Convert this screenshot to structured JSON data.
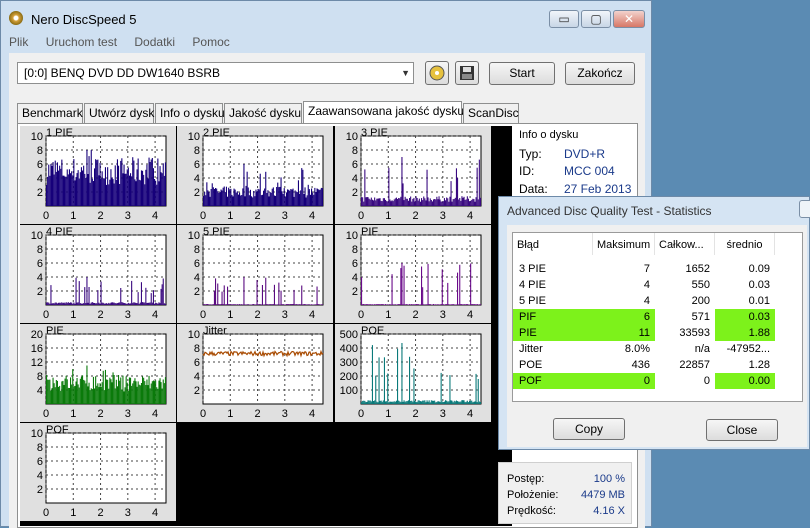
{
  "window": {
    "title": "Nero DiscSpeed 5",
    "minimize": "▭",
    "maximize": "▢",
    "close": "✕"
  },
  "menu": [
    "Plik",
    "Uruchom test",
    "Dodatki",
    "Pomoc"
  ],
  "toolbar": {
    "drive": "[0:0]   BENQ DVD DD DW1640 BSRB",
    "start": "Start",
    "stop": "Zakończ"
  },
  "tabs": [
    "Benchmark",
    "Utwórz dysk",
    "Info o dysku",
    "Jakość dysku",
    "Zaawansowana jakość dysku",
    "ScanDisc"
  ],
  "active_tab": 4,
  "disc_info": {
    "header": "Info o dysku",
    "rows": [
      {
        "k": "Typ:",
        "v": "DVD+R"
      },
      {
        "k": "ID:",
        "v": "MCC 004"
      },
      {
        "k": "Data:",
        "v": "27 Feb 2013"
      }
    ]
  },
  "stats_dialog": {
    "title": "Advanced Disc Quality Test - Statistics",
    "columns": [
      "Błąd",
      "Maksimum",
      "Całkow...",
      "średnio"
    ],
    "rows": [
      {
        "name": "3 PIE",
        "max": "7",
        "total": "1652",
        "avg": "0.09",
        "hl": false
      },
      {
        "name": "4 PIE",
        "max": "4",
        "total": "550",
        "avg": "0.03",
        "hl": false
      },
      {
        "name": "5 PIE",
        "max": "4",
        "total": "200",
        "avg": "0.01",
        "hl": false
      },
      {
        "name": "PIF",
        "max": "6",
        "total": "571",
        "avg": "0.03",
        "hl": true
      },
      {
        "name": "PIE",
        "max": "11",
        "total": "33593",
        "avg": "1.88",
        "hl": true
      },
      {
        "name": "Jitter",
        "max": "8.0%",
        "total": "n/a",
        "avg": "-47952...",
        "hl": false
      },
      {
        "name": "POE",
        "max": "436",
        "total": "22857",
        "avg": "1.28",
        "hl": false
      },
      {
        "name": "POF",
        "max": "0",
        "total": "0",
        "avg": "0.00",
        "hl": true
      }
    ],
    "copy": "Copy",
    "close": "Close",
    "highlight_color": "#7df21b"
  },
  "progress": {
    "rows": [
      {
        "k": "Postęp:",
        "v": "100 %"
      },
      {
        "k": "Położenie:",
        "v": "4479 MB"
      },
      {
        "k": "Prędkość:",
        "v": "4.16 X"
      }
    ]
  },
  "chart_data": [
    {
      "type": "bar",
      "title": "1 PIE",
      "yticks": [
        "10",
        "8",
        "6",
        "4",
        "2"
      ],
      "xticks": [
        "0",
        "1",
        "2",
        "3",
        "4"
      ],
      "ylim": [
        0,
        10
      ],
      "xlim": [
        0,
        4.4
      ],
      "color": "#16007a",
      "level": 5,
      "peak": 8
    },
    {
      "type": "bar",
      "title": "2 PIE",
      "yticks": [
        "10",
        "8",
        "6",
        "4",
        "2"
      ],
      "xticks": [
        "0",
        "1",
        "2",
        "3",
        "4"
      ],
      "ylim": [
        0,
        10
      ],
      "xlim": [
        0,
        4.4
      ],
      "color": "#16007a",
      "level": 2,
      "peak": 6
    },
    {
      "type": "bar",
      "title": "3 PIE",
      "yticks": [
        "10",
        "8",
        "6",
        "4",
        "2"
      ],
      "xticks": [
        "0",
        "1",
        "2",
        "3",
        "4"
      ],
      "ylim": [
        0,
        10
      ],
      "xlim": [
        0,
        4.4
      ],
      "color": "#3a0a80",
      "level": 1,
      "peak": 7
    },
    {
      "type": "bar",
      "title": "4 PIE",
      "yticks": [
        "10",
        "8",
        "6",
        "4",
        "2"
      ],
      "xticks": [
        "0",
        "1",
        "2",
        "3",
        "4"
      ],
      "ylim": [
        0,
        10
      ],
      "xlim": [
        0,
        4.4
      ],
      "color": "#3a0a80",
      "level": 0.3,
      "peak": 4
    },
    {
      "type": "bar",
      "title": "5 PIE",
      "yticks": [
        "10",
        "8",
        "6",
        "4",
        "2"
      ],
      "xticks": [
        "0",
        "1",
        "2",
        "3",
        "4"
      ],
      "ylim": [
        0,
        10
      ],
      "xlim": [
        0,
        4.4
      ],
      "color": "#5a0a80",
      "level": 0.1,
      "peak": 4
    },
    {
      "type": "bar",
      "title": "PIF",
      "yticks": [
        "10",
        "8",
        "6",
        "4",
        "2"
      ],
      "xticks": [
        "0",
        "1",
        "2",
        "3",
        "4"
      ],
      "ylim": [
        0,
        10
      ],
      "xlim": [
        0,
        4.4
      ],
      "color": "#6a0a8a",
      "level": 0.1,
      "peak": 6
    },
    {
      "type": "bar",
      "title": "PIE",
      "yticks": [
        "20",
        "16",
        "12",
        "8",
        "4"
      ],
      "xticks": [
        "0",
        "1",
        "2",
        "3",
        "4"
      ],
      "ylim": [
        0,
        20
      ],
      "xlim": [
        0,
        4.4
      ],
      "color": "#0a7a0a",
      "level": 6,
      "peak": 11
    },
    {
      "type": "line",
      "title": "Jitter",
      "yticks": [
        "10",
        "8",
        "6",
        "4",
        "2"
      ],
      "xticks": [
        "0",
        "1",
        "2",
        "3",
        "4"
      ],
      "ylim": [
        0,
        10
      ],
      "xlim": [
        0,
        4.4
      ],
      "color": "#a84a00",
      "level": 7.2,
      "peak": 8
    },
    {
      "type": "bar",
      "title": "POE",
      "yticks": [
        "500",
        "400",
        "300",
        "200",
        "100"
      ],
      "xticks": [
        "0",
        "1",
        "2",
        "3",
        "4"
      ],
      "ylim": [
        0,
        500
      ],
      "xlim": [
        0,
        4.4
      ],
      "color": "#0a7a7a",
      "level": 20,
      "peak": 436
    },
    {
      "type": "bar",
      "title": "POF",
      "yticks": [
        "10",
        "8",
        "6",
        "4",
        "2"
      ],
      "xticks": [
        "0",
        "1",
        "2",
        "3",
        "4"
      ],
      "ylim": [
        0,
        10
      ],
      "xlim": [
        0,
        4.4
      ],
      "color": "#16007a",
      "level": 0,
      "peak": 0
    }
  ]
}
